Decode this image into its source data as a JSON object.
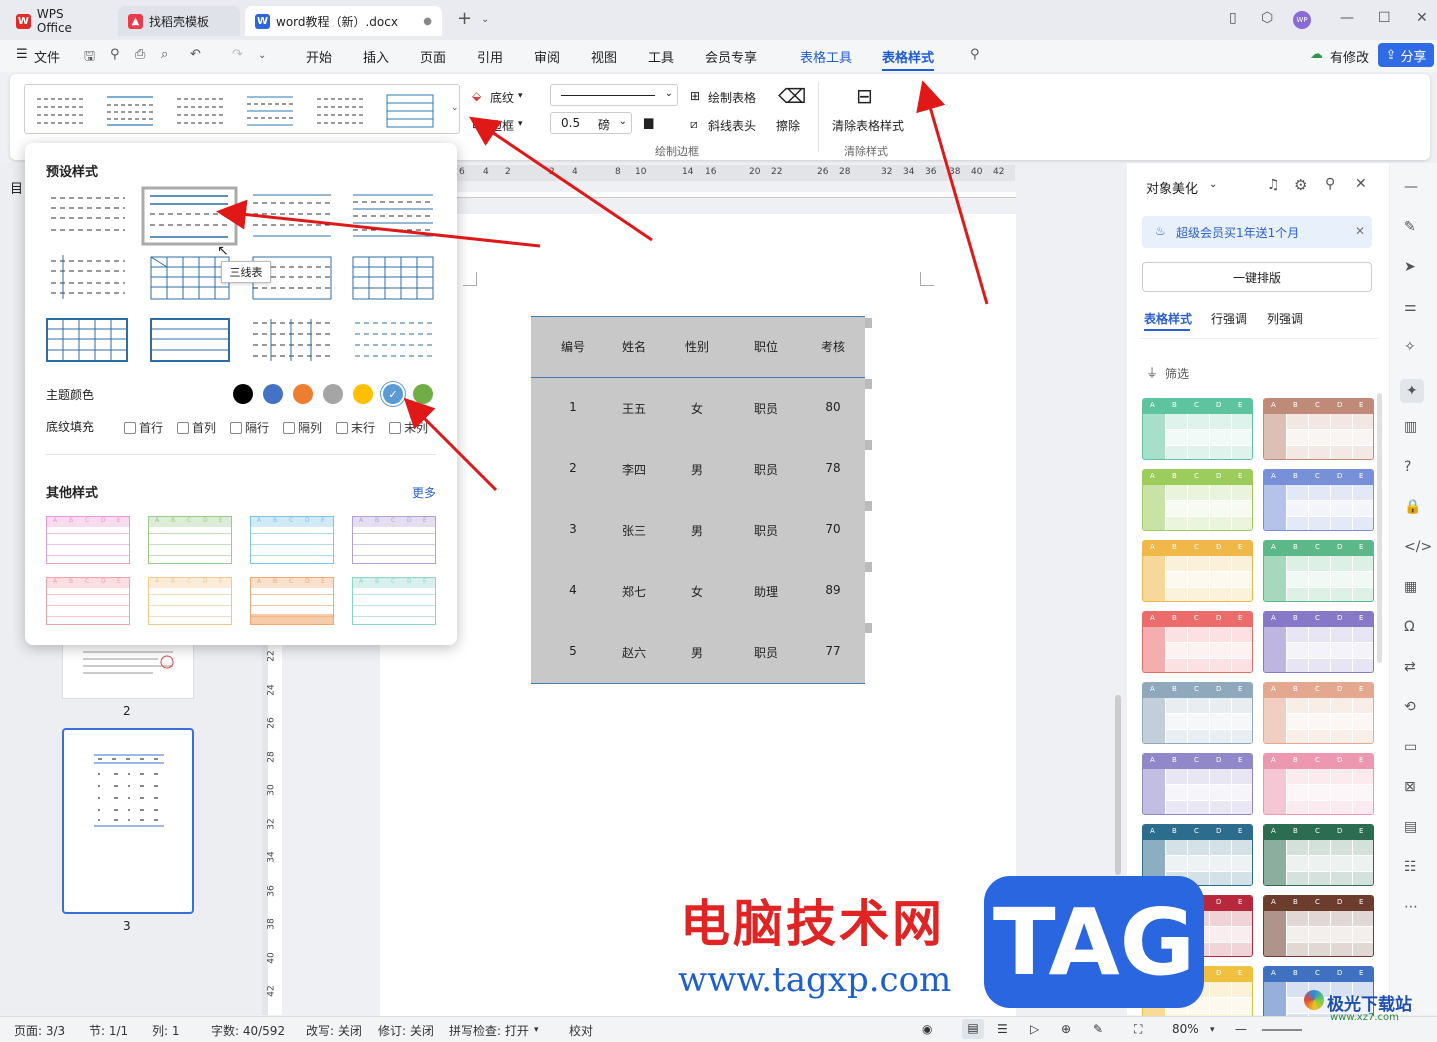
{
  "tabs": [
    {
      "label": "WPS Office",
      "icon": "wps-logo-icon",
      "color": "#e02b2b"
    },
    {
      "label": "找稻壳模板",
      "icon": "docer-icon",
      "color": "#e83b4b"
    },
    {
      "label": "word教程（新）.docx",
      "icon": "word-doc-icon",
      "color": "#2e63d9"
    }
  ],
  "window": {
    "user_avatar": "WP"
  },
  "menu": {
    "file": "文件",
    "items": [
      "开始",
      "插入",
      "页面",
      "引用",
      "审阅",
      "视图",
      "工具",
      "会员专享"
    ],
    "table_tools": "表格工具",
    "table_style": "表格样式",
    "modified": "有修改",
    "share": "分享"
  },
  "ribbon": {
    "shading": "底纹",
    "border": "边框",
    "line_width": "0.5",
    "unit": "磅",
    "draw_table": "绘制表格",
    "diagonal_header": "斜线表头",
    "erase": "擦除",
    "clear_table_style": "清除表格样式",
    "group_draw_border": "绘制边框",
    "group_clear_style": "清除样式"
  },
  "dropdown": {
    "preset_title": "预设样式",
    "tooltip": "三线表",
    "theme_color_label": "主题颜色",
    "theme_colors": [
      "#000000",
      "#4472c4",
      "#ed7d31",
      "#a5a5a5",
      "#ffc000",
      "#5b9bd5",
      "#70ad47"
    ],
    "selected_color_index": 5,
    "fill_label": "底纹填充",
    "fill_options": [
      "首行",
      "首列",
      "隔行",
      "隔列",
      "末行",
      "末列"
    ],
    "other_title": "其他样式",
    "more": "更多",
    "other_colors": [
      "#e89ad4",
      "#9ccc8c",
      "#7cc4e4",
      "#b4a0d8",
      "#f0a0a8",
      "#f0c890",
      "#f0a870",
      "#8cd4c8"
    ]
  },
  "ruler": {
    "top_ticks": [
      "6",
      "4",
      "2",
      "2",
      "4",
      "8",
      "10",
      "14",
      "16",
      "20",
      "22",
      "26",
      "28",
      "32",
      "34",
      "36",
      "38",
      "40",
      "42"
    ],
    "side_ticks": [
      "22",
      "24",
      "26",
      "28",
      "30",
      "32",
      "34",
      "36",
      "38",
      "40",
      "42"
    ]
  },
  "sidebar": {
    "label": "目",
    "pages": [
      "2",
      "3"
    ]
  },
  "table": {
    "headers": [
      "编号",
      "姓名",
      "性别",
      "职位",
      "考核"
    ],
    "rows": [
      [
        "1",
        "王五",
        "女",
        "职员",
        "80"
      ],
      [
        "2",
        "李四",
        "男",
        "职员",
        "78"
      ],
      [
        "3",
        "张三",
        "男",
        "职员",
        "70"
      ],
      [
        "4",
        "郑七",
        "女",
        "助理",
        "89"
      ],
      [
        "5",
        "赵六",
        "男",
        "职员",
        "77"
      ]
    ]
  },
  "panel": {
    "title": "对象美化",
    "promo": "超级会员买1年送1个月",
    "one_click": "一键排版",
    "tabs": [
      "表格样式",
      "行强调",
      "列强调"
    ],
    "filter": "筛选",
    "letters": [
      "A",
      "B",
      "C",
      "D",
      "E"
    ],
    "style_colors": [
      "#5ec4a0",
      "#c08a78",
      "#9ccc5c",
      "#7890d8",
      "#f0b848",
      "#5cb888",
      "#ec6c6c",
      "#8878c8",
      "#90a8bc",
      "#e4a890",
      "#9088c8",
      "#ec98b0",
      "#2c6c8c",
      "#2c6c50",
      "#b8283c",
      "#6c3c2c",
      "#f0c040",
      "#4070c0"
    ]
  },
  "watermark": {
    "cn": "电脑技术网",
    "url": "www.tagxp.com",
    "tag": "TAG",
    "brand": "极光下载站",
    "brand_url": "www.xz7.com"
  },
  "status": {
    "page": "页面: 3/3",
    "section": "节: 1/1",
    "column": "列: 1",
    "words": "字数: 40/592",
    "overwrite": "改写: 关闭",
    "revision": "修订: 关闭",
    "spell": "拼写检查: 打开",
    "proof": "校对",
    "zoom": "80%"
  }
}
